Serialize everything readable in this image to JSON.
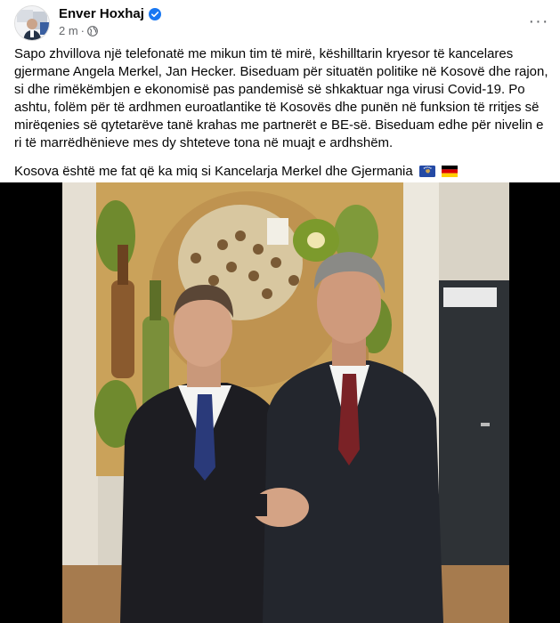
{
  "post": {
    "author": "Enver Hoxhaj",
    "time": "2 m",
    "separator": "·",
    "paragraphs": [
      "Sapo zhvillova një telefonatë me mikun tim të mirë, këshilltarin kryesor të kancelares gjermane Angela Merkel, Jan Hecker. Biseduam për situatën politike në Kosovë dhe rajon, si dhe rimëkëmbjen e ekonomisë pas pandemisë së shkaktuar nga virusi Covid-19. Po ashtu, folëm për të ardhmen euroatlantike të Kosovës dhe punën në funksion të rritjes së mirëqenies së qytetarëve tanë krahas me partnerët e BE-së. Biseduam edhe për nivelin e ri të marrëdhënieve mes dy shteteve tona në muajt e ardhshëm.",
      "Kosova është me fat që ka miq si Kancelarja Merkel dhe Gjermania"
    ],
    "more_label": "···"
  },
  "icons": {
    "verified": "verified-badge-icon",
    "privacy": "globe-icon",
    "flag_1": "kosovo-flag-icon",
    "flag_2": "germany-flag-icon",
    "more": "more-options-icon"
  },
  "colors": {
    "verified_blue": "#1877f2",
    "meta_gray": "#65676b",
    "text": "#050505"
  }
}
